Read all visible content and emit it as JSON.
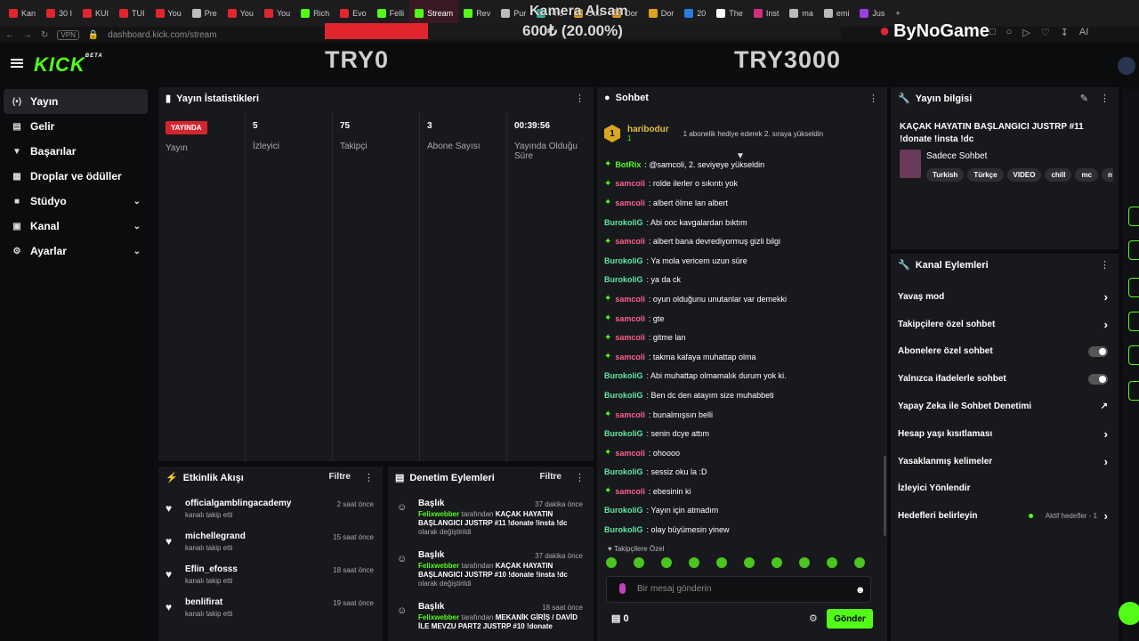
{
  "browser": {
    "tabs": [
      {
        "label": "Kan",
        "color": "#e0252f"
      },
      {
        "label": "30 I",
        "color": "#e0252f"
      },
      {
        "label": "KUI",
        "color": "#e0252f"
      },
      {
        "label": "TUI",
        "color": "#e0252f"
      },
      {
        "label": "You",
        "color": "#e0252f"
      },
      {
        "label": "Pre",
        "color": "#bbbbbb"
      },
      {
        "label": "You",
        "color": "#e0252f"
      },
      {
        "label": "You",
        "color": "#e0252f"
      },
      {
        "label": "Rich",
        "color": "#53fc18"
      },
      {
        "label": "Evo",
        "color": "#e0252f"
      },
      {
        "label": "Felli",
        "color": "#53fc18"
      },
      {
        "label": "Stream",
        "color": "#53fc18"
      },
      {
        "label": "Rev",
        "color": "#53fc18"
      },
      {
        "label": "Pur",
        "color": "#bbbbbb"
      },
      {
        "label": "Pho",
        "color": "#3bb5a0"
      },
      {
        "label": "Ödü",
        "color": "#e0a020"
      },
      {
        "label": "Dor",
        "color": "#e0a020"
      },
      {
        "label": "Dor",
        "color": "#e0a020"
      },
      {
        "label": "20",
        "color": "#2a7be0"
      },
      {
        "label": "The",
        "color": "#ffffff"
      },
      {
        "label": "Inst",
        "color": "#d0307a"
      },
      {
        "label": "ma",
        "color": "#bbbbbb"
      },
      {
        "label": "emi",
        "color": "#bbbbbb"
      },
      {
        "label": "Jus",
        "color": "#9a40e0"
      }
    ],
    "active_tab_index": 11,
    "vpn_label": "VPN",
    "url": "dashboard.kick.com/stream",
    "ai_label": "AI"
  },
  "overlay": {
    "title": "Kamera Alsam",
    "amount_text": "600₺ (20.00%)",
    "progress": 0.2,
    "min_label": "TRY0",
    "max_label": "TRY3000",
    "sponsor": "ByNoGame"
  },
  "brand": {
    "logo": "KICK",
    "beta": "BETA",
    "accent": "#53fc18"
  },
  "sidebar": {
    "items": [
      {
        "label": "Yayın",
        "icon": "broadcast-icon",
        "active": true
      },
      {
        "label": "Gelir",
        "icon": "revenue-icon"
      },
      {
        "label": "Başarılar",
        "icon": "trophy-icon"
      },
      {
        "label": "Droplar ve ödüller",
        "icon": "gift-icon"
      },
      {
        "label": "Stüdyo",
        "icon": "studio-icon",
        "chevron": true
      },
      {
        "label": "Kanal",
        "icon": "channel-icon",
        "chevron": true
      },
      {
        "label": "Ayarlar",
        "icon": "gear-icon",
        "chevron": true
      }
    ]
  },
  "stats": {
    "title": "Yayın İstatistikleri",
    "live_badge": "YAYINDA",
    "cards": [
      {
        "value": "",
        "label": "Yayın"
      },
      {
        "value": "5",
        "label": "İzleyici"
      },
      {
        "value": "75",
        "label": "Takipçi"
      },
      {
        "value": "3",
        "label": "Abone Sayısı"
      },
      {
        "value": "00:39:56",
        "label": "Yayında Olduğu Süre"
      }
    ]
  },
  "activity": {
    "title": "Etkinlik Akışı",
    "filter": "Filtre",
    "items": [
      {
        "name": "officialgamblingacademy",
        "sub": "kanalı takip etti",
        "time": "2 saat önce"
      },
      {
        "name": "michellegrand",
        "sub": "kanalı takip etti",
        "time": "15 saat önce"
      },
      {
        "name": "Eflin_efosss",
        "sub": "kanalı takip etti",
        "time": "18 saat önce"
      },
      {
        "name": "benlifirat",
        "sub": "kanalı takip etti",
        "time": "19 saat önce"
      }
    ]
  },
  "moderation": {
    "title": "Denetim Eylemleri",
    "filter": "Filtre",
    "items": [
      {
        "title": "Başlık",
        "who": "Felixwebber",
        "mid": " tarafından ",
        "target": "KAÇAK HAYATIN BAŞLANGICI JUSTRP #11 !donate !insta !dc",
        "end": " olarak değiştirildi",
        "time": "37 dakika önce"
      },
      {
        "title": "Başlık",
        "who": "Felixwebber",
        "mid": " tarafından ",
        "target": "KAÇAK HAYATIN BAŞLANGICI JUSTRP #10 !donate !insta !dc",
        "end": " olarak değiştirildi",
        "time": "37 dakika önce"
      },
      {
        "title": "Başlık",
        "who": "Felixwebber",
        "mid": " tarafından ",
        "target": "MEKANİK GİRİŞ / DAVİD İLE MEVZU PART2 JUSTRP #10 !donate",
        "end": "",
        "time": "18 saat önce"
      }
    ]
  },
  "chat": {
    "title": "Sohbet",
    "pinned_user": "haribodur",
    "pinned_rank": "1",
    "pinned_count": "1",
    "pinned_text": "1 abonelik hediye ederek 2. sıraya yükseldin",
    "messages": [
      {
        "user": "BotRix",
        "text": ": @samcoli, 2. seviyeye yükseldin",
        "color": "#53fc18",
        "gem": true
      },
      {
        "user": "samcoli",
        "text": ": rolde ilerler o sıkıntı yok",
        "color": "#ff5f8f",
        "gem": true
      },
      {
        "user": "samcoli",
        "text": ": albert ölme lan albert",
        "color": "#ff5f8f",
        "gem": true
      },
      {
        "user": "BurokoliG",
        "text": ": Abi ooc kavgalardan bıktım",
        "color": "#5fe8a0",
        "gem": false
      },
      {
        "user": "samcoli",
        "text": ": albert bana devrediyormuş gizli bilgi",
        "color": "#ff5f8f",
        "gem": true
      },
      {
        "user": "BurokoliG",
        "text": ": Ya mola vericem uzun süre",
        "color": "#5fe8a0",
        "gem": false
      },
      {
        "user": "BurokoliG",
        "text": ": ya da ck",
        "color": "#5fe8a0",
        "gem": false
      },
      {
        "user": "samcoli",
        "text": ": oyun olduğunu unutanlar var demekki",
        "color": "#ff5f8f",
        "gem": true
      },
      {
        "user": "samcoli",
        "text": ": gte",
        "color": "#ff5f8f",
        "gem": true
      },
      {
        "user": "samcoli",
        "text": ": gitme lan",
        "color": "#ff5f8f",
        "gem": true
      },
      {
        "user": "samcoli",
        "text": ": takma kafaya muhattap olma",
        "color": "#ff5f8f",
        "gem": true
      },
      {
        "user": "BurokoliG",
        "text": ": Abi muhattap olmamalık durum yok ki.",
        "color": "#5fe8a0",
        "gem": false
      },
      {
        "user": "BurokoliG",
        "text": ": Ben dc den atayım size muhabbeti",
        "color": "#5fe8a0",
        "gem": false
      },
      {
        "user": "samcoli",
        "text": ": bunalmışsın belli",
        "color": "#ff5f8f",
        "gem": true
      },
      {
        "user": "BurokoliG",
        "text": ": senin dcye attım",
        "color": "#5fe8a0",
        "gem": false
      },
      {
        "user": "samcoli",
        "text": ": ohoooo",
        "color": "#ff5f8f",
        "gem": true
      },
      {
        "user": "BurokoliG",
        "text": ": sessiz oku la :D",
        "color": "#5fe8a0",
        "gem": false
      },
      {
        "user": "samcoli",
        "text": ": ebesinin ki",
        "color": "#ff5f8f",
        "gem": true
      },
      {
        "user": "BurokoliG",
        "text": ": Yayın için atmadım",
        "color": "#5fe8a0",
        "gem": false
      },
      {
        "user": "BurokoliG",
        "text": ": olay büyümesin yinew",
        "color": "#5fe8a0",
        "gem": false
      }
    ],
    "followers_only": "Takipçilere Özel",
    "placeholder": "Bir mesaj gönderin",
    "points": "0",
    "send_label": "Gönder"
  },
  "stream_info": {
    "title": "Yayın bilgisi",
    "stream_title": "KAÇAK HAYATIN BAŞLANGICI JUSTRP #11 !donate !insta !dc",
    "category": "Sadece Sohbet",
    "tags": [
      "Turkish",
      "Türkçe",
      "VIDEO",
      "chill",
      "mc",
      "n"
    ]
  },
  "channel_actions": {
    "title": "Kanal Eylemleri",
    "items": [
      {
        "label": "Yavaş mod",
        "control": "chevron"
      },
      {
        "label": "Takipçilere özel sohbet",
        "control": "chevron"
      },
      {
        "label": "Abonelere özel sohbet",
        "control": "toggle"
      },
      {
        "label": "Yalnızca ifadelerle sohbet",
        "control": "toggle"
      },
      {
        "label": "Yapay Zeka ile Sohbet Denetimi",
        "control": "external"
      },
      {
        "label": "Hesap yaşı kısıtlaması",
        "control": "chevron"
      },
      {
        "label": "Yasaklanmış kelimeler",
        "control": "chevron"
      },
      {
        "label": "İzleyici Yönlendir",
        "control": "none"
      },
      {
        "label": "Hedefleri belirleyin",
        "control": "chevron"
      }
    ],
    "goals_status": "Aktif hedefler - 1"
  }
}
